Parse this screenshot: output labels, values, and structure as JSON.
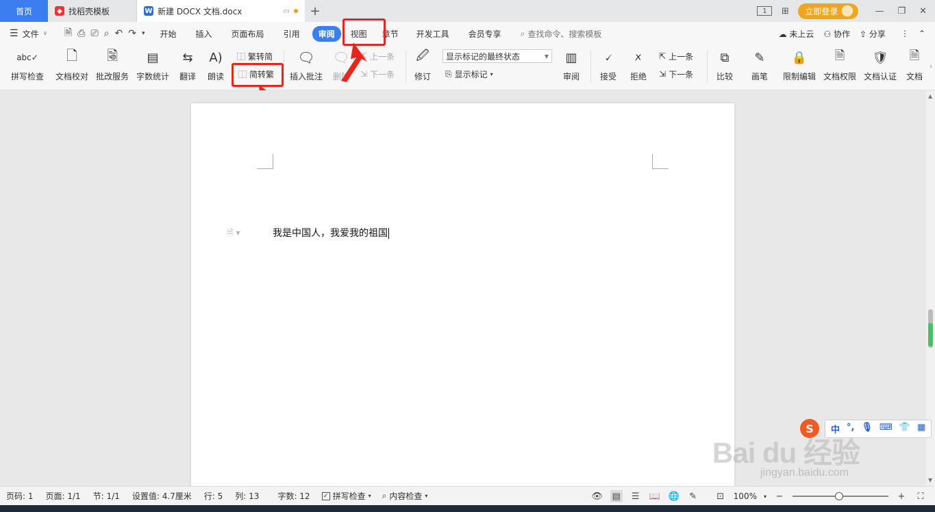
{
  "tabs": {
    "home": "首页",
    "template": "找稻壳模板",
    "doc": "新建 DOCX 文档.docx",
    "add": "+"
  },
  "title_right": {
    "login": "立即登录",
    "page_view_icon": "1"
  },
  "menu": {
    "file": "文件",
    "items": [
      "开始",
      "插入",
      "页面布局",
      "引用",
      "审阅",
      "视图",
      "章节",
      "开发工具",
      "会员专享"
    ],
    "active": "审阅",
    "search": "查找命令、搜索模板",
    "right": [
      "未上云",
      "协作",
      "分享"
    ]
  },
  "ribbon": {
    "spell": "拼写检查",
    "proofread": "文档校对",
    "correct": "批改服务",
    "wordcount": "字数统计",
    "translate": "翻译",
    "read": "朗读",
    "to_simplified": "繁转简",
    "to_traditional": "简转繁",
    "insert_comment": "插入批注",
    "delete": "删除",
    "prev": "上一条",
    "next": "下一条",
    "revise": "修订",
    "markup_state": "显示标记的最终状态",
    "show_markup": "显示标记",
    "review": "审阅",
    "accept": "接受",
    "reject": "拒绝",
    "prev2": "上一条",
    "next2": "下一条",
    "compare": "比较",
    "pen": "画笔",
    "restrict": "限制编辑",
    "rights": "文档权限",
    "certify": "文档认证",
    "more": "文档"
  },
  "document": {
    "text": "我是中国人，我爱我的祖国"
  },
  "ime": {
    "logo": "S",
    "mode": "中",
    "punct": "°,"
  },
  "watermark": {
    "main": "Bai du 经验",
    "sub": "jingyan.baidu.com"
  },
  "status": {
    "page_num": "页码: 1",
    "pages": "页面: 1/1",
    "section": "节: 1/1",
    "setting": "设置值: 4.7厘米",
    "row": "行: 5",
    "col": "列: 13",
    "words": "字数: 12",
    "spell": "拼写检查",
    "content_check": "内容检查",
    "zoom": "100%"
  },
  "colors": {
    "accent": "#3b7ef0",
    "highlight": "#e8261e",
    "login": "#f0a51e"
  }
}
